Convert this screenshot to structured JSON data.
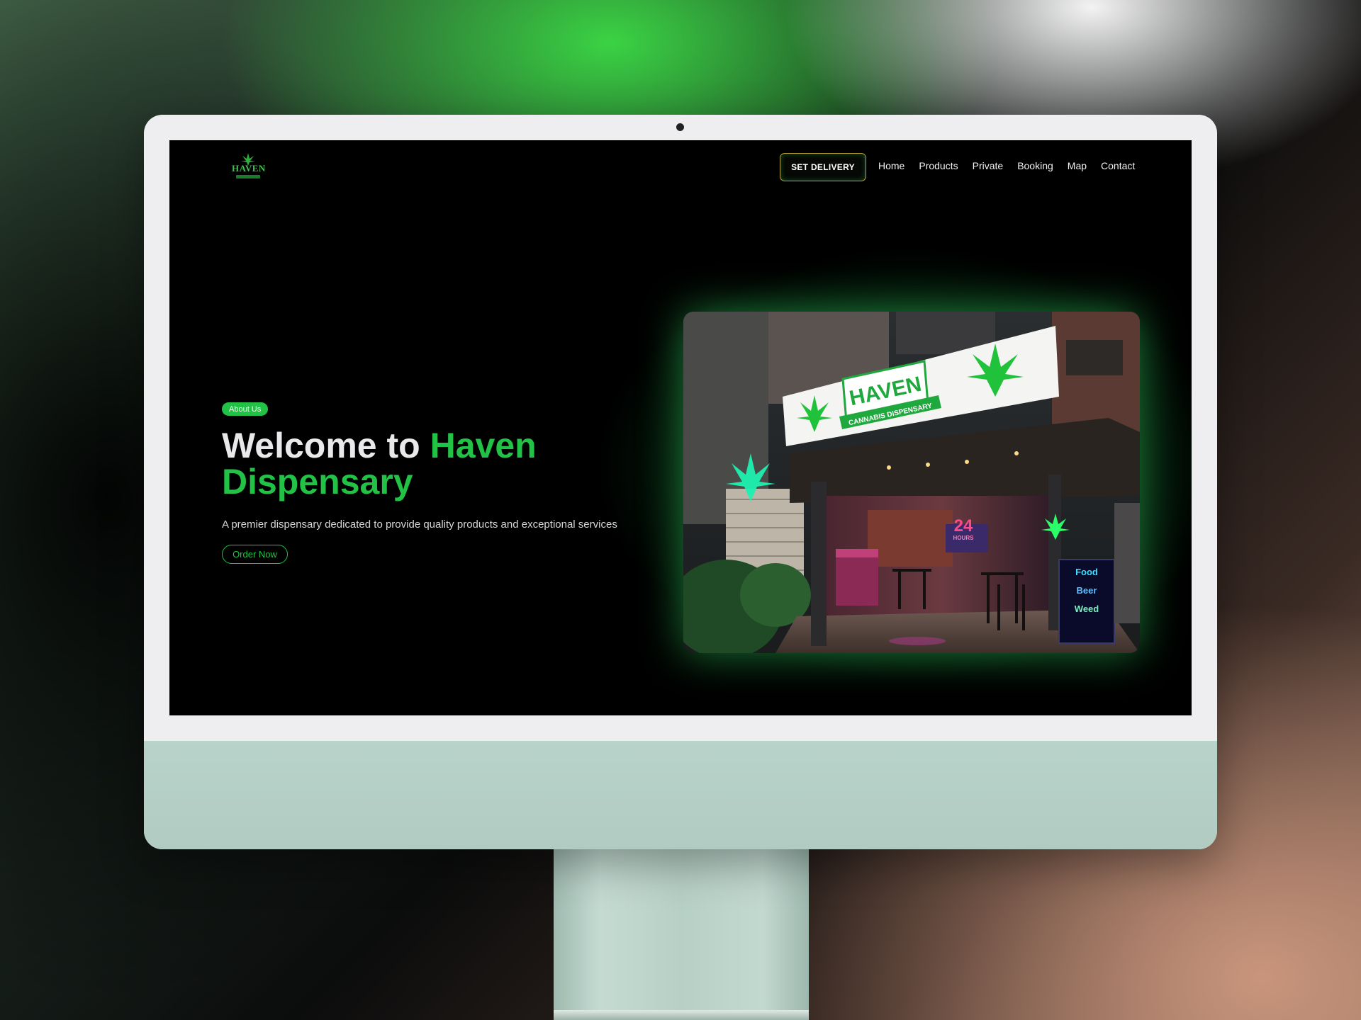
{
  "logo": {
    "text": "HAVEN"
  },
  "nav": {
    "delivery_button": "SET DELIVERY",
    "links": [
      "Home",
      "Products",
      "Private",
      "Booking",
      "Map",
      "Contact"
    ]
  },
  "hero": {
    "badge": "About Us",
    "title_part1": "Welcome to ",
    "title_accent": "Haven Dispensary",
    "subtitle": "A premier dispensary dedicated to provide quality products and exceptional services",
    "cta": "Order Now"
  },
  "photo": {
    "sign_name": "HAVEN",
    "sign_tagline": "CANNABIS DISPENSARY",
    "neon_hours": "24",
    "neon_hours_label": "HOURS",
    "board_lines": [
      "Food",
      "Beer",
      "Weed"
    ]
  },
  "colors": {
    "accent_green": "#22c247",
    "page_bg": "#000000",
    "monitor_body": "#b8d3ca",
    "delivery_border": "#b8a33a"
  }
}
